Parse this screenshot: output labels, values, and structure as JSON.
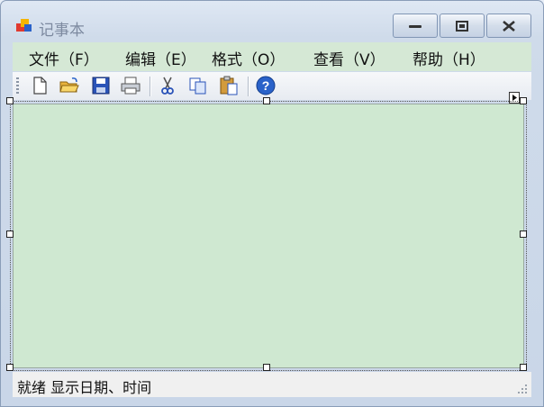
{
  "window": {
    "title": "记事本",
    "controls": {
      "minimize": "minimize",
      "maximize": "maximize",
      "close": "close"
    }
  },
  "menubar": {
    "items": [
      {
        "label": "文件（F）"
      },
      {
        "label": "编辑（E）"
      },
      {
        "label": "格式（O）"
      },
      {
        "label": "查看（V）"
      },
      {
        "label": "帮助（H）"
      }
    ]
  },
  "toolbar": {
    "buttons": [
      {
        "icon": "new-file-icon"
      },
      {
        "icon": "open-folder-icon"
      },
      {
        "icon": "save-icon"
      },
      {
        "icon": "print-icon"
      },
      {
        "icon": "cut-icon"
      },
      {
        "icon": "copy-icon"
      },
      {
        "icon": "paste-icon"
      },
      {
        "icon": "help-icon"
      }
    ]
  },
  "editor": {
    "text": "",
    "background": "#cfe8d1"
  },
  "statusbar": {
    "text": "就绪  显示日期、时间"
  },
  "colors": {
    "menubar_bg": "#d5e8d5",
    "editor_bg": "#cfe8d1",
    "help_blue": "#2a62c9"
  }
}
